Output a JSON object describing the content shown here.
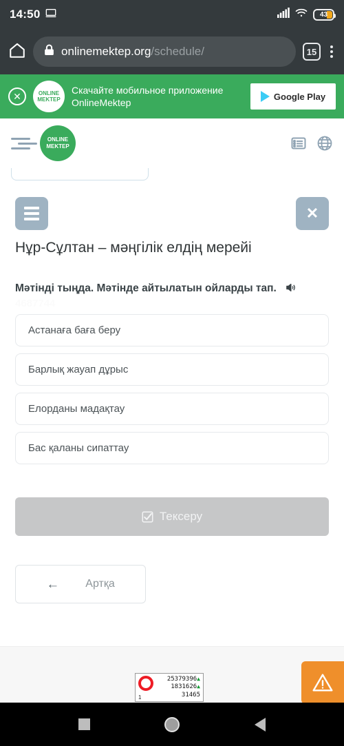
{
  "status_bar": {
    "clock": "14:50",
    "cast_icon": "cast-screen-icon",
    "signal_icon": "cellular-signal-icon",
    "wifi_icon": "wifi-icon",
    "battery_icon": "battery-icon",
    "battery_level": "43"
  },
  "browser": {
    "home_icon": "home-icon",
    "lock_icon": "lock-icon",
    "url_domain": "onlinemektep.org",
    "url_path": "/schedule/",
    "tab_count": "15",
    "menu_icon": "kebab-menu-icon"
  },
  "promo_banner": {
    "close_icon": "close-circle-icon",
    "logo_line1": "ONLINE",
    "logo_line2": "MEKTEP",
    "text_line1": "Скачайте мобильное приложение",
    "text_line2": "OnlineMektep",
    "store_badge": "Google Play",
    "store_icon": "google-play-icon",
    "background": "#3aab5c"
  },
  "site_header": {
    "menu_icon": "menu-indent-icon",
    "logo_line1": "ONLINE",
    "logo_line2": "MEKTEP",
    "list_icon": "list-icon",
    "globe_icon": "globe-icon"
  },
  "lesson": {
    "menu_button_icon": "hamburger-icon",
    "close_button_icon": "close-icon",
    "title": "Нұр-Сұлтан – мәңгілік елдің мерейі",
    "question": "Мәтінді тыңда. Мәтінде айтылатын ойларды тап.",
    "audio_icon": "speaker-icon",
    "watermark": "4687744",
    "options": [
      {
        "label": "Астанаға баға беру"
      },
      {
        "label": "Барлық жауап дұрыс"
      },
      {
        "label": "Елорданы мадақтау"
      },
      {
        "label": "Бас қаланы сипаттау"
      }
    ],
    "check_button": {
      "label": "Тексеру",
      "icon": "checkbox-icon"
    },
    "back_button": {
      "label": "Артқа",
      "icon": "arrow-left-icon"
    }
  },
  "footer": {
    "counter": {
      "ring_icon": "liveinternet-ring-icon",
      "ring_color": "#ee1c25",
      "index": "1",
      "rows": [
        {
          "value": "25379396",
          "trend": "▲"
        },
        {
          "value": "1831626",
          "trend": "▲"
        },
        {
          "value": "31465",
          "trend": ""
        }
      ]
    },
    "warning_button": {
      "icon": "warning-triangle-icon",
      "color": "#ef8f2b"
    }
  },
  "nav_bar": {
    "recent_icon": "recent-apps-icon",
    "home_icon": "home-circle-icon",
    "back_icon": "back-triangle-icon"
  }
}
